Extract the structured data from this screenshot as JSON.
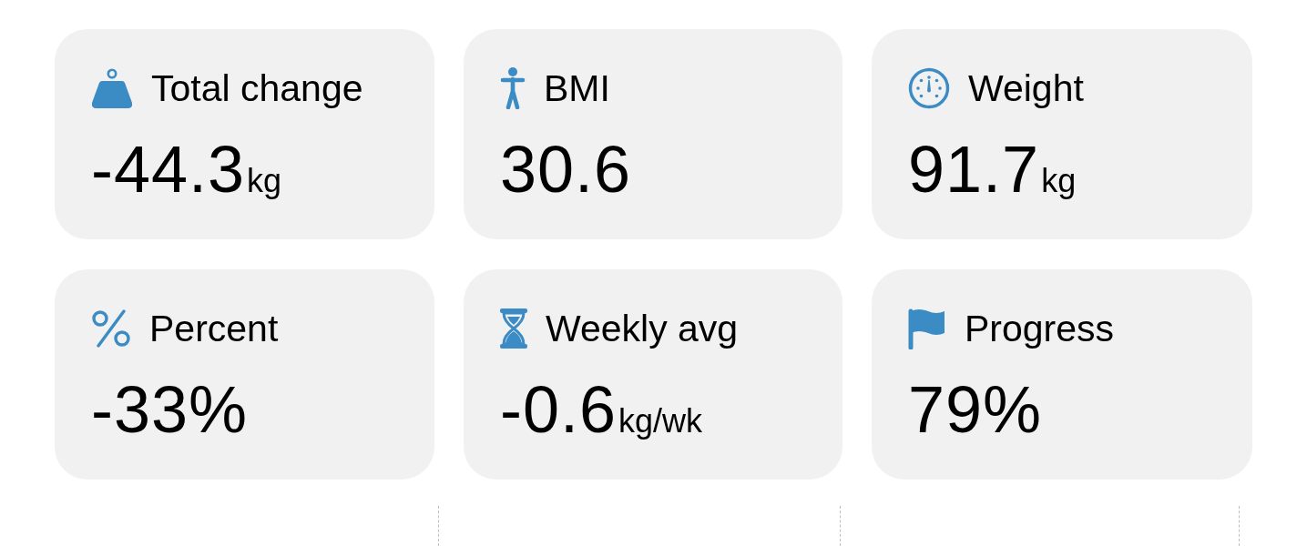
{
  "stats": [
    {
      "title": "Total change",
      "value": "-44.3",
      "unit": "kg"
    },
    {
      "title": "BMI",
      "value": "30.6"
    },
    {
      "title": "Weight",
      "value": "91.7",
      "unit": "kg"
    },
    {
      "title": "Percent",
      "value": "-33%"
    },
    {
      "title": "Weekly avg",
      "value": "-0.6",
      "unit": "kg/wk"
    },
    {
      "title": "Progress",
      "value": "79%"
    }
  ]
}
